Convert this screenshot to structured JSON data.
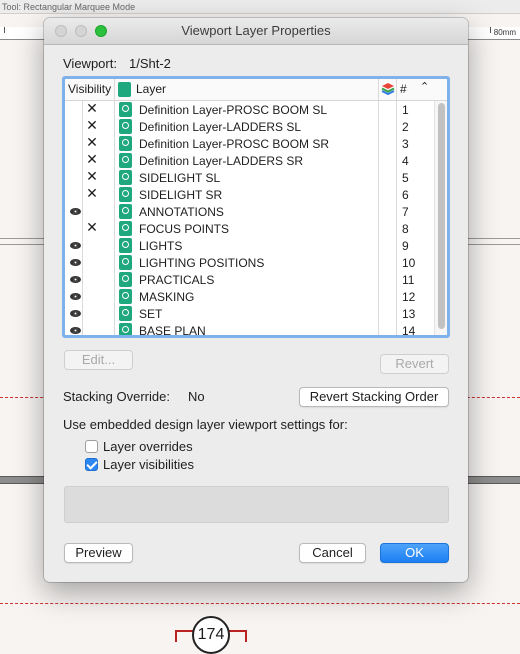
{
  "background": {
    "tool_label": "Tool: Rectangular Marquee Mode",
    "ruler_label": "80mm",
    "bubble_number": "174"
  },
  "dialog": {
    "title": "Viewport Layer Properties",
    "viewport_label": "Viewport:",
    "viewport_value": "1/Sht-2",
    "table": {
      "col_visibility": "Visibility",
      "col_layer": "Layer",
      "col_number": "#",
      "rows": [
        {
          "visibility": "invisible",
          "name": "Definition Layer-PROSC BOOM SL",
          "number": "1"
        },
        {
          "visibility": "invisible",
          "name": "Definition Layer-LADDERS SL",
          "number": "2"
        },
        {
          "visibility": "invisible",
          "name": "Definition Layer-PROSC BOOM SR",
          "number": "3"
        },
        {
          "visibility": "invisible",
          "name": "Definition Layer-LADDERS SR",
          "number": "4"
        },
        {
          "visibility": "invisible",
          "name": "SIDELIGHT SL",
          "number": "5"
        },
        {
          "visibility": "invisible",
          "name": "SIDELIGHT SR",
          "number": "6"
        },
        {
          "visibility": "visible",
          "name": "ANNOTATIONS",
          "number": "7"
        },
        {
          "visibility": "invisible",
          "name": "FOCUS POINTS",
          "number": "8"
        },
        {
          "visibility": "visible",
          "name": "LIGHTS",
          "number": "9"
        },
        {
          "visibility": "visible",
          "name": "LIGHTING POSITIONS",
          "number": "10"
        },
        {
          "visibility": "visible",
          "name": "PRACTICALS",
          "number": "11"
        },
        {
          "visibility": "visible",
          "name": "MASKING",
          "number": "12"
        },
        {
          "visibility": "visible",
          "name": "SET",
          "number": "13"
        },
        {
          "visibility": "visible",
          "name": "BASE PLAN",
          "number": "14"
        }
      ]
    },
    "edit_button": "Edit...",
    "revert_button": "Revert",
    "stacking_override_label": "Stacking Override:",
    "stacking_override_value": "No",
    "revert_stacking_button": "Revert Stacking Order",
    "embedded_settings_label": "Use embedded design layer viewport settings for:",
    "layer_overrides_label": "Layer overrides",
    "layer_overrides_checked": false,
    "layer_visibilities_label": "Layer visibilities",
    "layer_visibilities_checked": true,
    "preview_button": "Preview",
    "cancel_button": "Cancel",
    "ok_button": "OK",
    "accent_color": "#1d7ff3",
    "layer_icon_color": "#1fa77d"
  }
}
